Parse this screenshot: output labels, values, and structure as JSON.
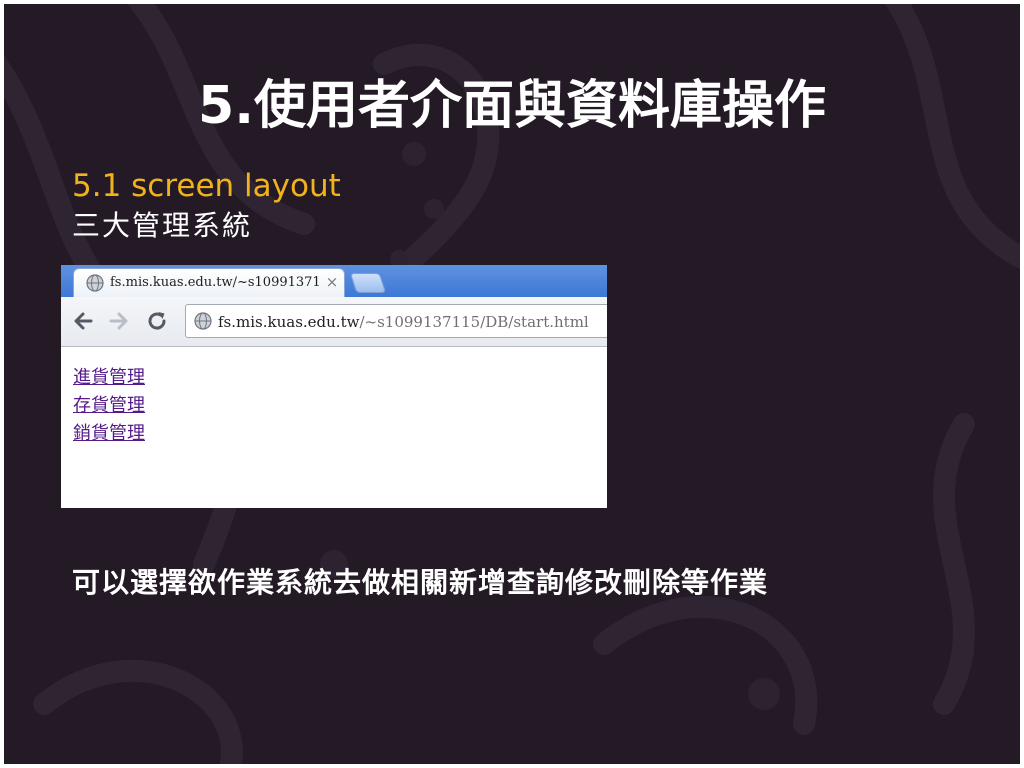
{
  "slide": {
    "title": "5.使用者介面與資料庫操作",
    "subtitle": "5.1 screen layout",
    "subtext": "三大管理系統",
    "footer_text": "可以選擇欲作業系統去做相關新增查詢修改刪除等作業"
  },
  "browser": {
    "tab": {
      "title": "fs.mis.kuas.edu.tw/~s10991371",
      "close_symbol": "×",
      "icon": "globe-icon"
    },
    "toolbar": {
      "back_icon": "back-arrow-icon",
      "forward_icon": "forward-arrow-icon",
      "reload_icon": "reload-icon"
    },
    "address": {
      "host": "fs.mis.kuas.edu.tw",
      "path": "/~s1099137115/DB/start.html"
    },
    "links": [
      {
        "label": "進貨管理"
      },
      {
        "label": "存貨管理"
      },
      {
        "label": "銷貨管理"
      }
    ]
  },
  "colors": {
    "background": "#241a26",
    "title": "#ffffff",
    "subtitle": "#f2b21b",
    "visited_link": "#551a8b",
    "tabstrip": "#3d78d6"
  }
}
